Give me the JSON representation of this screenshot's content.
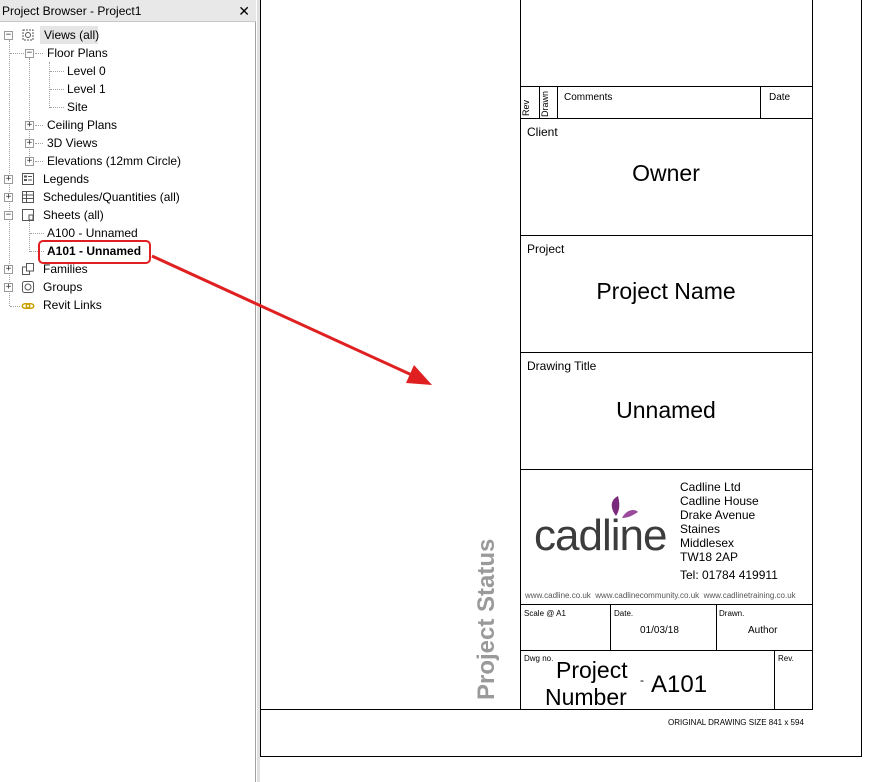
{
  "browser": {
    "title": "Project Browser - Project1",
    "close_glyph": "✕",
    "items": {
      "views": "Views (all)",
      "floor_plans": "Floor Plans",
      "level0": "Level 0",
      "level1": "Level 1",
      "site": "Site",
      "ceiling_plans": "Ceiling Plans",
      "views3d": "3D Views",
      "elevations": "Elevations (12mm Circle)",
      "legends": "Legends",
      "schedules": "Schedules/Quantities (all)",
      "sheets": "Sheets (all)",
      "a100": "A100 - Unnamed",
      "a101": "A101 - Unnamed",
      "families": "Families",
      "groups": "Groups",
      "revit_links": "Revit Links"
    },
    "expand_minus": "−",
    "expand_plus": "+"
  },
  "titleblock": {
    "rev_header": "Rev",
    "drawn_header": "Drawn",
    "comments_header": "Comments",
    "date_header": "Date",
    "client_label": "Client",
    "client_value": "Owner",
    "project_label": "Project",
    "project_value": "Project Name",
    "drawing_title_label": "Drawing Title",
    "drawing_title_value": "Unnamed",
    "logo_text": "cadline",
    "address": [
      "Cadline Ltd",
      "Cadline House",
      "Drake Avenue",
      "Staines",
      "Middlesex",
      "TW18 2AP"
    ],
    "tel": "Tel: 01784 419911",
    "websites": "www.cadline.co.uk  www.cadlinecommunity.co.uk  www.cadlinetraining.co.uk",
    "scale_label": "Scale @ A1",
    "date_label": "Date.",
    "date_value": "01/03/18",
    "drawn_label": "Drawn.",
    "drawn_value": "Author",
    "dwg_label": "Dwg no.",
    "project_number_line1": "Project",
    "project_number_line2": "Number",
    "dash": "-",
    "sheet_number": "A101",
    "rev_label": "Rev.",
    "project_status": "Project Status",
    "original_size": "ORIGINAL DRAWING SIZE  841 x 594"
  },
  "colors": {
    "highlight": "#e02020",
    "logo_purple": "#7a2a7a",
    "logo_gray": "#3c3c3c",
    "status_gray": "#9a9a9a"
  }
}
